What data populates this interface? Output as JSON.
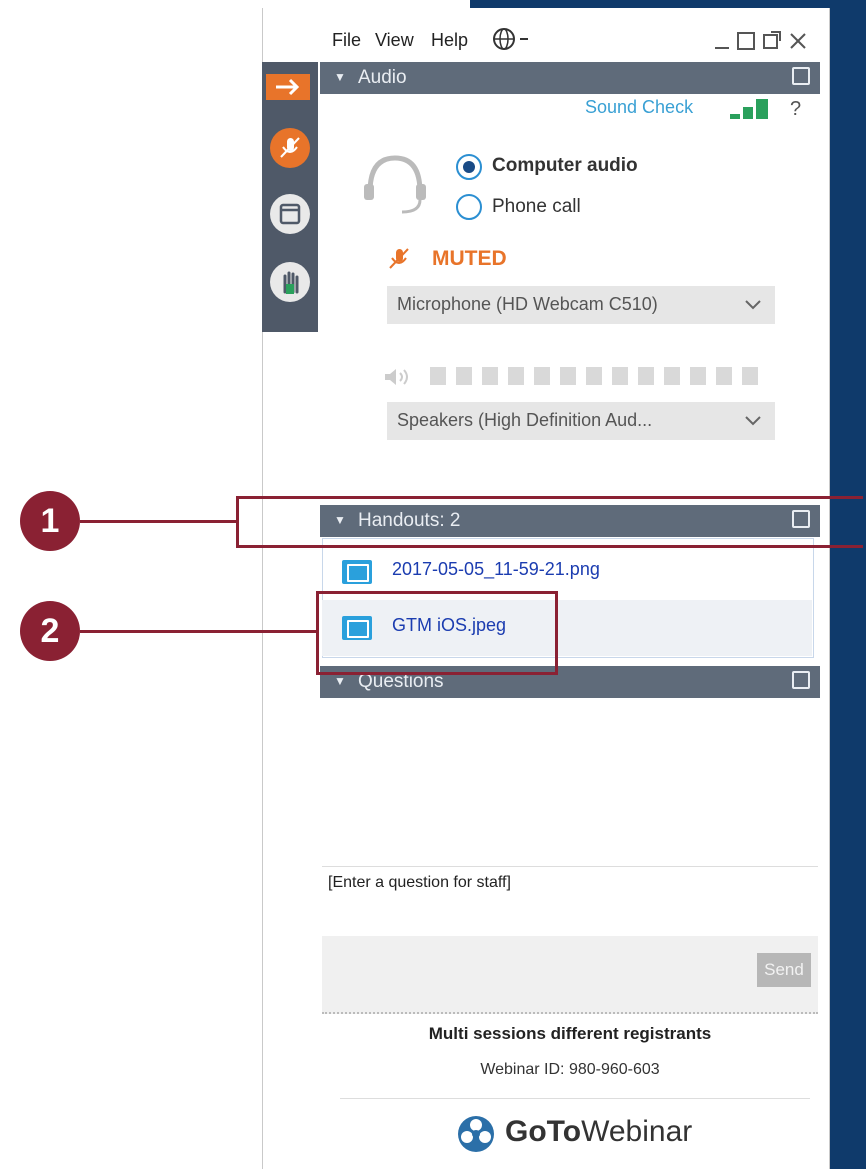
{
  "menu": {
    "file": "File",
    "view": "View",
    "help": "Help"
  },
  "audio": {
    "title": "Audio",
    "sound_check": "Sound Check",
    "help_mark": "?",
    "options": [
      {
        "label": "Computer audio",
        "selected": true
      },
      {
        "label": "Phone call",
        "selected": false
      }
    ],
    "muted_label": "MUTED",
    "microphone": "Microphone (HD Webcam C510)",
    "speakers": "Speakers (High Definition Aud..."
  },
  "handouts": {
    "title": "Handouts: 2",
    "files": [
      {
        "name": "2017-05-05_11-59-21.png"
      },
      {
        "name": "GTM iOS.jpeg"
      }
    ]
  },
  "questions": {
    "title": "Questions",
    "placeholder": "[Enter a question for staff]",
    "send_label": "Send"
  },
  "footer": {
    "session_title": "Multi sessions different registrants",
    "webinar_id": "Webinar ID: 980-960-603",
    "brand_bold": "GoTo",
    "brand_rest": "Webinar"
  },
  "callouts": [
    "1",
    "2"
  ],
  "colors": {
    "accent_orange": "#e8742a",
    "header_gray": "#5f6b7a",
    "link_blue": "#1b3cb0",
    "callout_red": "#8a2133",
    "navy": "#0f3a6b"
  },
  "icons": [
    "globe-icon",
    "minimize-icon",
    "maximize-icon",
    "popout-icon",
    "close-icon",
    "arrow-exit-icon",
    "mic-muted-icon",
    "window-icon",
    "raise-hand-icon",
    "headset-icon",
    "speaker-icon",
    "image-file-icon",
    "chevron-down-icon",
    "gotowebinar-logo-icon"
  ]
}
